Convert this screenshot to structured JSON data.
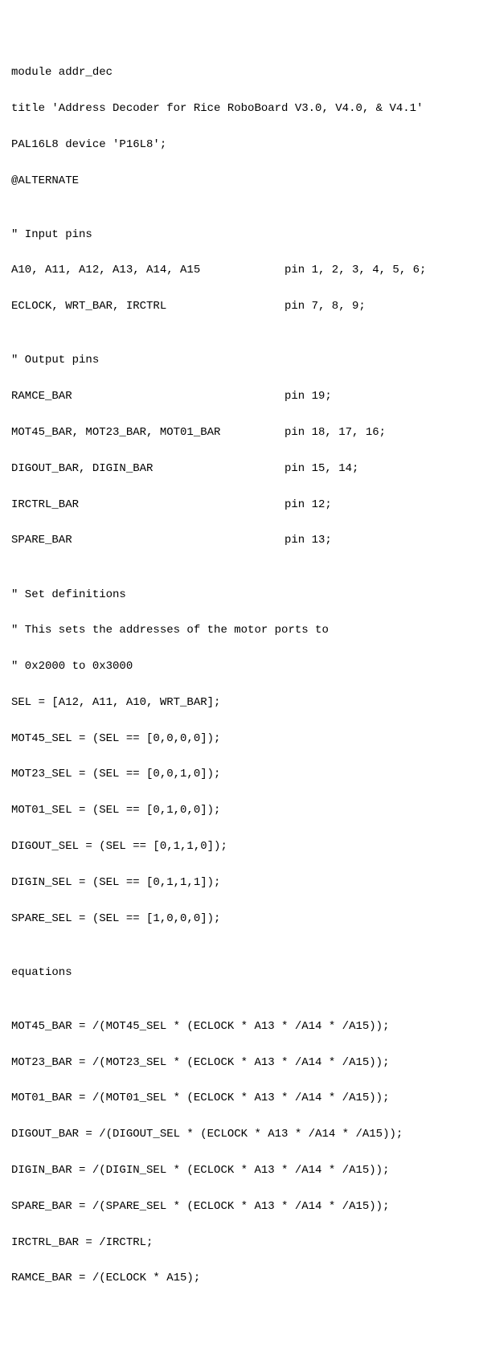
{
  "l1": "module addr_dec",
  "l2": "title 'Address Decoder for Rice RoboBoard V3.0, V4.0, & V4.1'",
  "l3": "PAL16L8 device 'P16L8';",
  "l4": "@ALTERNATE",
  "blank": "",
  "l5": "\" Input pins",
  "r1a": "A10, A11, A12, A13, A14, A15",
  "r1b": "pin 1, 2, 3, 4, 5, 6;",
  "r2a": "ECLOCK, WRT_BAR, IRCTRL",
  "r2b": "pin 7, 8, 9;",
  "l6": "\" Output pins",
  "r3a": "RAMCE_BAR",
  "r3b": "pin 19;",
  "r4a": "MOT45_BAR, MOT23_BAR, MOT01_BAR",
  "r4b": "pin 18, 17, 16;",
  "r5a": "DIGOUT_BAR, DIGIN_BAR",
  "r5b": "pin 15, 14;",
  "r6a": "IRCTRL_BAR",
  "r6b": "pin 12;",
  "r7a": "SPARE_BAR",
  "r7b": "pin 13;",
  "l7": "\" Set definitions",
  "l8": "\" This sets the addresses of the motor ports to",
  "l9": "\" 0x2000 to 0x3000",
  "l10": "SEL = [A12, A11, A10, WRT_BAR];",
  "l11": "MOT45_SEL = (SEL == [0,0,0,0]);",
  "l12": "MOT23_SEL = (SEL == [0,0,1,0]);",
  "l13": "MOT01_SEL = (SEL == [0,1,0,0]);",
  "l14": "DIGOUT_SEL = (SEL == [0,1,1,0]);",
  "l15": "DIGIN_SEL = (SEL == [0,1,1,1]);",
  "l16": "SPARE_SEL = (SEL == [1,0,0,0]);",
  "l17": "equations",
  "l18": "MOT45_BAR = /(MOT45_SEL * (ECLOCK * A13 * /A14 * /A15));",
  "l19": "MOT23_BAR = /(MOT23_SEL * (ECLOCK * A13 * /A14 * /A15));",
  "l20": "MOT01_BAR = /(MOT01_SEL * (ECLOCK * A13 * /A14 * /A15));",
  "l21": "DIGOUT_BAR = /(DIGOUT_SEL * (ECLOCK * A13 * /A14 * /A15));",
  "l22": "DIGIN_BAR = /(DIGIN_SEL * (ECLOCK * A13 * /A14 * /A15));",
  "l23": "SPARE_BAR = /(SPARE_SEL * (ECLOCK * A13 * /A14 * /A15));",
  "l24": "IRCTRL_BAR = /IRCTRL;",
  "l25": "RAMCE_BAR = /(ECLOCK * A15);"
}
